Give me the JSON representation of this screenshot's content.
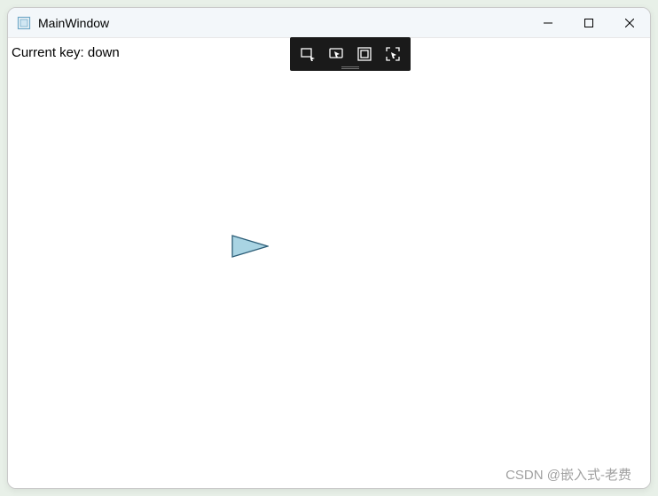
{
  "window": {
    "title": "MainWindow"
  },
  "status": {
    "label_prefix": "Current key: ",
    "current_key": "down"
  },
  "triangle": {
    "fill": "#a9d4e3",
    "stroke": "#2b5d77"
  },
  "snip_toolbar": {
    "icons": {
      "rect_snip": "rectangular-snip-icon",
      "cursor_snip": "cursor-region-icon",
      "window_snip": "window-snip-icon",
      "fullscreen_snip": "fullscreen-snip-icon"
    }
  },
  "watermark": "CSDN @嵌入式-老费"
}
